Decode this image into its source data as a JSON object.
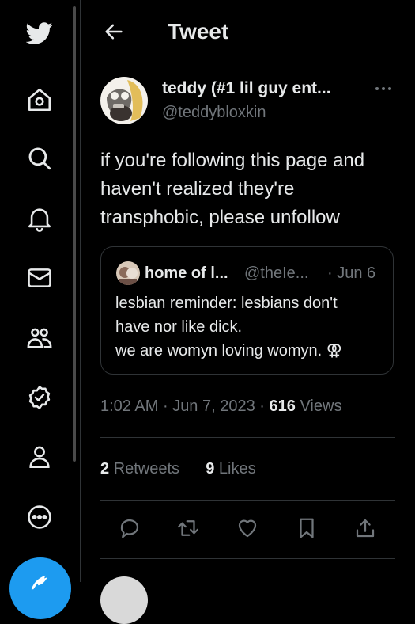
{
  "colors": {
    "accent": "#1d9bf0",
    "background": "#000000",
    "text": "#e7e9ea",
    "muted": "#71767b",
    "border": "#2f3336"
  },
  "sidebar": {
    "items": [
      {
        "icon": "twitter-bird-icon"
      },
      {
        "icon": "home-icon"
      },
      {
        "icon": "search-icon"
      },
      {
        "icon": "bell-icon"
      },
      {
        "icon": "mail-icon"
      },
      {
        "icon": "communities-icon"
      },
      {
        "icon": "verified-icon"
      },
      {
        "icon": "profile-icon"
      },
      {
        "icon": "more-circle-icon"
      }
    ],
    "compose_icon": "compose-icon"
  },
  "header": {
    "title": "Tweet",
    "back_icon": "arrow-left-icon"
  },
  "tweet": {
    "display_name": "teddy (#1 lil guy ent...",
    "handle": "@teddybloxkin",
    "text_lines": [
      "if you're following this page and",
      "haven't realized they're",
      "transphobic, please unfollow"
    ],
    "quote": {
      "display_name": "home of l...",
      "handle": "@theIe...",
      "date": "· Jun 6",
      "text_lines": [
        "lesbian reminder: lesbians don't",
        "have nor like dick.",
        "we are womyn loving womyn. ⚢"
      ]
    },
    "time": "1:02 AM",
    "sep1": "·",
    "date": "Jun 7, 2023",
    "sep2": "·",
    "views_count": "616",
    "views_label": "Views",
    "retweets_count": "2",
    "retweets_label": "Retweets",
    "likes_count": "9",
    "likes_label": "Likes"
  },
  "actions": [
    "reply-icon",
    "retweet-icon",
    "like-icon",
    "bookmark-icon",
    "share-icon"
  ]
}
